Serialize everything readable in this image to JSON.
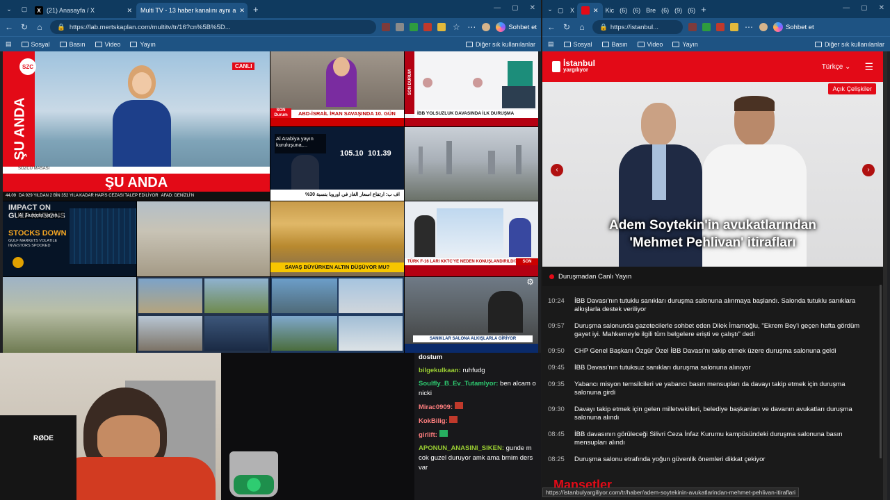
{
  "left": {
    "tabs": [
      {
        "label": "(21) Anasayfa / X"
      },
      {
        "label": "Multi TV - 13 haber kanalını aynı a"
      }
    ],
    "url": "https://lab.mertskaplan.com/multitv/tr/16?cn%5B%5D...",
    "chat_label": "Sohbet et",
    "bookmarks": [
      "Sosyal",
      "Basın",
      "Video",
      "Yayın"
    ],
    "bookmarks_right": "Diğer sık kullanılanlar",
    "tiles": {
      "szc_logo": "SZC",
      "su_anda_v": "ŞU ANDA",
      "canli": "CANLI",
      "sozcu_masasi": "SÖZCÜ MASASI",
      "su_anda": "ŞU ANDA",
      "szc_ticker": "DA 929 YILDAN 2 BİN 352 YILA KADAR HAPİS CEZASI TALEP EDİLİYOR",
      "szc_temp": "44,09",
      "szc_afad": "AFAD: DENİZLİ'N",
      "ch2_tag": "SON Durum",
      "ch2_ticker": "ABD-İSRAİL İRAN SAVAŞINDA 10. GÜN",
      "ch3_tag": "SON DURUM",
      "ch3_ticker": "İBB YOLSUZLUK DAVASINDA İLK DURUŞMA",
      "ch4_caption": "Al Arabiya yayın kuruluşuna,...",
      "ch4_v1": "105.10",
      "ch4_v2": "101.39",
      "ch4_ticker": "%30 اف ب: ارتفاع اسعار الغاز في اوروبا بنسبة",
      "aj_caption": "Al Jazeera yayın...",
      "aj_big1": "IMPACT ON",
      "aj_big2": "GULF NATIONS",
      "aj_h1": "STOCKS DOWN",
      "aj_h2": "GULF MARKETS VOLATILE",
      "aj_h3": "INVESTORS SPOOKED",
      "gold_ticker": "SAVAŞ BÜYÜRKEN ALTIN DÜŞÜYOR MU?",
      "trt_ticker": "TÜRK F-16 LARI KKTC'YE NEDEN KONUŞLANDIRILDI?",
      "trt_tag": "SON",
      "court_ticker": "SANIKLAR SALONA ALKIŞLARLA GİRİYOR"
    },
    "chat": [
      {
        "name": "",
        "text": "dostum",
        "color": "#ffffff"
      },
      {
        "name": "bilgekulkaan:",
        "text": "ruhfudg",
        "color": "#9acd32"
      },
      {
        "name": "Soulfly_B_Ev_Tutamlyor:",
        "text": "ben alcam o nicki",
        "color": "#2ecc71"
      },
      {
        "name": "Mirac0909:",
        "text": "",
        "color": "#ff7f7f"
      },
      {
        "name": "KokBilig:",
        "text": "",
        "color": "#ff7f7f"
      },
      {
        "name": "girlift:",
        "text": "",
        "color": "#ff7f7f"
      },
      {
        "name": "APONUN_ANASINI_SIKEN:",
        "text": "gunde m cok guzel duruyor amk ama brnim ders var",
        "color": "#9acd32"
      }
    ],
    "mic_label": "RØDE"
  },
  "right": {
    "url": "https://istanbul...",
    "chat_label": "Sohbet et",
    "bookmarks": [
      "Sosyal",
      "Basın",
      "Video",
      "Yayın"
    ],
    "bookmarks_right": "Diğer sık kullanılanlar",
    "tab_labels": [
      "X",
      "(6)",
      "Kic",
      "(6)",
      "(6)",
      "Bre",
      "(6)",
      "(9)",
      "(6)"
    ],
    "site_logo_1": "İstanbul",
    "site_logo_2": "yargılıyor",
    "language": "Türkçe",
    "badge": "Açık Çelişkiler",
    "hero_title_1": "Adem Soytekin'in avukatlarından",
    "hero_title_2": "'Mehmet Pehlivan' itirafları",
    "live_label": "Duruşmadan Canlı Yayın",
    "feed": [
      {
        "time": "10:24",
        "text": "İBB Davası'nın tutuklu sanıkları duruşma salonuna alınmaya başlandı. Salonda tutuklu sanıklara alkışlarla destek veriliyor"
      },
      {
        "time": "09:57",
        "text": "Duruşma salonunda gazetecilerle sohbet eden Dilek İmamoğlu, \"Ekrem Bey'i geçen hafta gördüm gayet iyi. Mahkemeyle ilgili tüm belgelere eriști ve çalıştı\" dedi"
      },
      {
        "time": "09:50",
        "text": "CHP Genel Başkanı Özgür Özel İBB Davası'nı takip etmek üzere duruşma salonuna geldi"
      },
      {
        "time": "09:45",
        "text": "İBB Davası'nın tutuksuz sanıkları duruşma salonuna alınıyor"
      },
      {
        "time": "09:35",
        "text": "Yabancı misyon temsilcileri ve yabancı basın mensupları da davayı takip etmek için duruşma salonuna girdi"
      },
      {
        "time": "09:30",
        "text": "Davayı takip etmek için gelen milletvekilleri, belediye başkanları ve davanın avukatları duruşma salonuna alındı"
      },
      {
        "time": "08:45",
        "text": "İBB davasının görüleceği Silivri Ceza İnfaz Kurumu kampüsündeki duruşma salonuna basın mensupları alındı"
      },
      {
        "time": "08:25",
        "text": "Duruşma salonu etrafında yoğun güvenlik önemleri dikkat çekiyor"
      }
    ],
    "section_heading": "Manşetler",
    "status_url": "https://istanbulyargiliyor.com/tr/haber/adem-soytekinin-avukatlarindan-mehmet-pehlivan-itiraflari"
  }
}
